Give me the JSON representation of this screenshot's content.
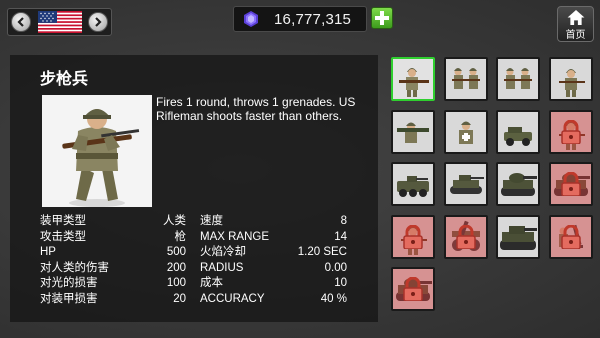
{
  "nation": {
    "flag": "usa-flag",
    "prev_icon": "chevron-left-icon",
    "next_icon": "chevron-right-icon"
  },
  "currency": {
    "value": "16,777,315",
    "icon": "gem-icon",
    "add_icon": "plus-icon"
  },
  "home": {
    "label": "首页",
    "icon": "home-icon"
  },
  "unit": {
    "title": "步枪兵",
    "description": "Fires 1 round, throws 1 grenades. US Rifleman shoots faster than others.",
    "stats_left": [
      {
        "label": "装甲类型",
        "value": "人类"
      },
      {
        "label": "攻击类型",
        "value": "枪"
      },
      {
        "label": "HP",
        "value": "500"
      },
      {
        "label": "对人类的伤害",
        "value": "200"
      },
      {
        "label": "对光的损害",
        "value": "100"
      },
      {
        "label": "对装甲损害",
        "value": "20"
      }
    ],
    "stats_right": [
      {
        "label": "速度",
        "value": "8"
      },
      {
        "label": "MAX RANGE",
        "value": "14"
      },
      {
        "label": "火焰冷却",
        "value": "1.20 SEC"
      },
      {
        "label": "RADIUS",
        "value": "0.00"
      },
      {
        "label": "成本",
        "value": "10"
      },
      {
        "label": "ACCURACY",
        "value": "40 %"
      }
    ]
  },
  "unit_grid": [
    {
      "type": "rifleman",
      "state": "selected"
    },
    {
      "type": "squad",
      "state": "unlocked"
    },
    {
      "type": "squad",
      "state": "unlocked"
    },
    {
      "type": "soldier",
      "state": "unlocked"
    },
    {
      "type": "bazooka",
      "state": "unlocked"
    },
    {
      "type": "medic",
      "state": "unlocked"
    },
    {
      "type": "jeep",
      "state": "unlocked"
    },
    {
      "type": "soldier",
      "state": "locked"
    },
    {
      "type": "armored-car",
      "state": "unlocked"
    },
    {
      "type": "light-tank",
      "state": "unlocked"
    },
    {
      "type": "tank",
      "state": "unlocked"
    },
    {
      "type": "tank",
      "state": "locked"
    },
    {
      "type": "soldier",
      "state": "locked"
    },
    {
      "type": "artillery",
      "state": "locked"
    },
    {
      "type": "heavy-tank",
      "state": "unlocked"
    },
    {
      "type": "mortar",
      "state": "locked"
    },
    {
      "type": "tank",
      "state": "locked"
    }
  ],
  "colors": {
    "selected_border": "#2fcf2f",
    "add_green": "#4caf27",
    "lock_red": "#d23c3c"
  }
}
